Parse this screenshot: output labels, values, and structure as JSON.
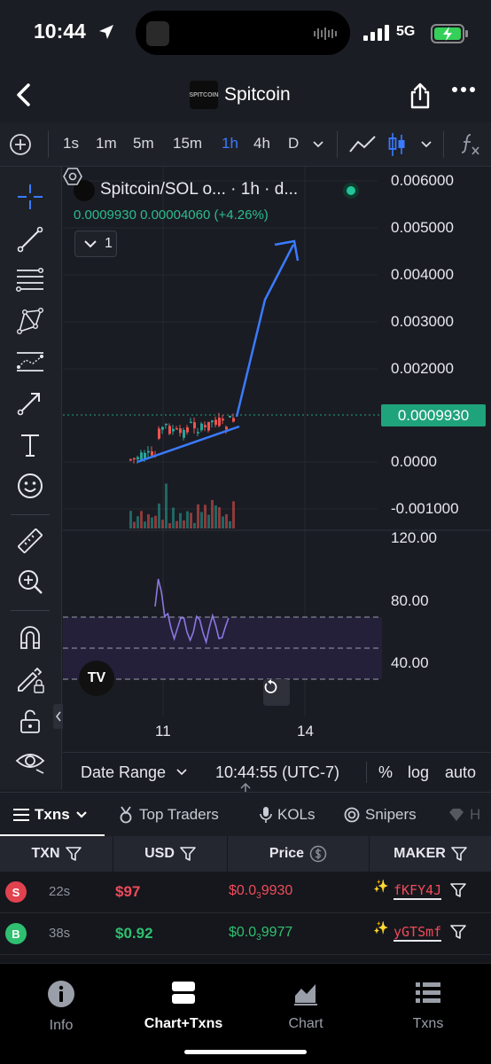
{
  "status_bar": {
    "time": "10:44",
    "network": "5G"
  },
  "header": {
    "title": "Spitcoin",
    "logo_text": "SPITCOIN"
  },
  "timeframes": [
    "1s",
    "1m",
    "5m",
    "15m",
    "1h",
    "4h",
    "D"
  ],
  "active_timeframe": "1h",
  "legend": {
    "title": "Spitcoin/SOL o... · 1h · d...",
    "values": "0.0009930  0.00004060 (+4.26%)",
    "indicator_count": "1"
  },
  "price_axis": [
    "0.006000",
    "0.005000",
    "0.004000",
    "0.003000",
    "0.002000",
    "0.0000",
    "-0.001000"
  ],
  "current_price_tag": "0.0009930",
  "rsi_axis": [
    "120.00",
    "80.00",
    "40.00"
  ],
  "x_axis": [
    "11",
    "14"
  ],
  "tv_logo": "TV",
  "chart_footer": {
    "date_range": "Date Range",
    "time": "10:44:55 (UTC-7)",
    "percent": "%",
    "log": "log",
    "auto": "auto"
  },
  "txn_tabs": [
    "Txns",
    "Top Traders",
    "KOLs",
    "Snipers",
    "H"
  ],
  "table": {
    "headers": [
      "TXN",
      "USD",
      "Price",
      "MAKER"
    ],
    "rows": [
      {
        "side": "S",
        "age": "22s",
        "usd": "$97",
        "price_prefix": "$0.0",
        "price_sub": "3",
        "price_digits": "9930",
        "maker": "fKFY4J",
        "color": "#f04b5b"
      },
      {
        "side": "B",
        "age": "38s",
        "usd": "$0.92",
        "price_prefix": "$0.0",
        "price_sub": "3",
        "price_digits": "9977",
        "maker": "yGTSmf",
        "color": "#2fbf71"
      }
    ]
  },
  "bottom_tabs": [
    "Info",
    "Chart+Txns",
    "Chart",
    "Txns"
  ],
  "active_bottom_tab": "Chart+Txns",
  "colors": {
    "up": "#26a69a",
    "down": "#ef5350",
    "accent": "#3a7bff",
    "rsi": "#8a78e0",
    "price_tag": "#1fa37a"
  }
}
